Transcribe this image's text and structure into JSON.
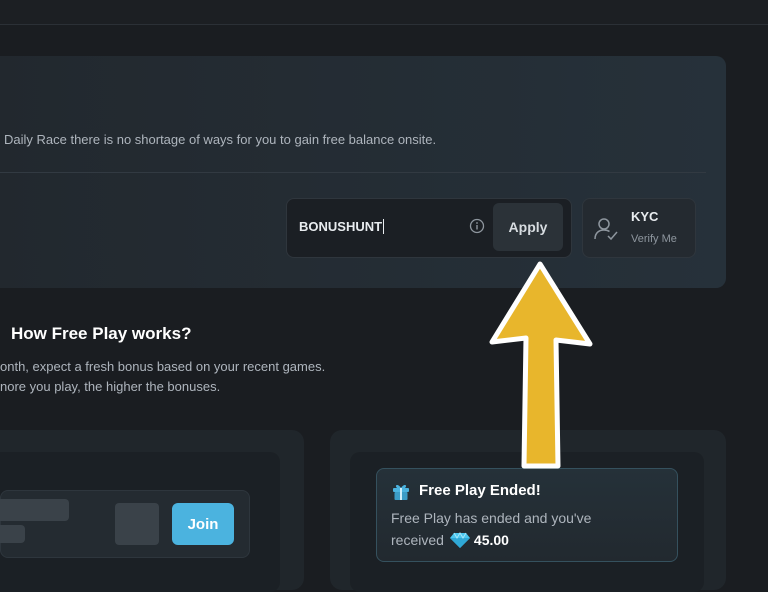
{
  "promo": {
    "description": "Daily Race there is no shortage of ways for you to gain free balance onsite.",
    "code_input": {
      "value": "BONUSHUNT"
    },
    "apply_label": "Apply",
    "kyc": {
      "title": "KYC",
      "subtitle": "Verify Me"
    }
  },
  "free_play": {
    "title": "How Free Play works?",
    "line1": "onth, expect a fresh bonus based on your recent games.",
    "line2": "nore you play, the higher the bonuses."
  },
  "join_card": {
    "join_label": "Join"
  },
  "ended_card": {
    "title": "Free Play Ended!",
    "text_line1": "Free Play has ended and you've",
    "text_line2": "received",
    "amount": "45.00"
  },
  "colors": {
    "accent": "#4bb3df",
    "annotation_arrow": "#e8b62c",
    "background": "#1a1d21"
  },
  "icons": [
    "info-icon",
    "user-check-icon",
    "gift-icon",
    "gem-icon"
  ]
}
